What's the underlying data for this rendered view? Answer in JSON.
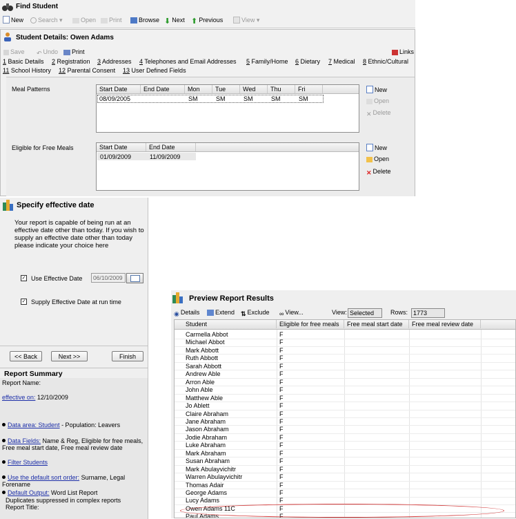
{
  "find_student": {
    "title": "Find Student",
    "toolbar": [
      "New",
      "Search",
      "Open",
      "Print",
      "Browse",
      "Next",
      "Previous",
      "View"
    ]
  },
  "student_details": {
    "title": "Student Details: Owen Adams",
    "toolbar": {
      "save": "Save",
      "undo": "Undo",
      "print": "Print",
      "links": "Links"
    },
    "tabs_row1": [
      {
        "num": "1",
        "label": "Basic Details"
      },
      {
        "num": "2",
        "label": "Registration"
      },
      {
        "num": "3",
        "label": "Addresses"
      },
      {
        "num": "4",
        "label": "Telephones and Email Addresses"
      },
      {
        "num": "5",
        "label": "Family/Home"
      },
      {
        "num": "6",
        "label": "Dietary"
      },
      {
        "num": "7",
        "label": "Medical"
      },
      {
        "num": "8",
        "label": "Ethnic/Cultural"
      }
    ],
    "tabs_row2": [
      {
        "num": "11",
        "label": "School History"
      },
      {
        "num": "12",
        "label": "Parental Consent"
      },
      {
        "num": "13",
        "label": "User Defined Fields"
      }
    ],
    "meal_patterns": {
      "label": "Meal Patterns",
      "columns": [
        "Start Date",
        "End Date",
        "Mon",
        "Tue",
        "Wed",
        "Thu",
        "Fri"
      ],
      "row": [
        "08/09/2005",
        "",
        "SM",
        "SM",
        "SM",
        "SM",
        "SM"
      ],
      "buttons": {
        "new": "New",
        "open": "Open",
        "delete": "Delete"
      }
    },
    "free_meals": {
      "label": "Eligible for Free Meals",
      "columns": [
        "Start Date",
        "End Date"
      ],
      "row": [
        "01/09/2009",
        "11/09/2009"
      ],
      "buttons": {
        "new": "New",
        "open": "Open",
        "delete": "Delete"
      }
    }
  },
  "effective_date": {
    "title": "Specify effective date",
    "description": "Your report is capable of being run at an effective date other than today. If you wish to supply an effective date other than  today please indicate your choice here",
    "use_effective_date": "Use Effective Date",
    "date_value": "06/10/2009",
    "supply_at_runtime": "Supply Effective Date at run time",
    "buttons": {
      "back": "<< Back",
      "next": "Next >>",
      "finish": "Finish"
    }
  },
  "report_summary": {
    "title": "Report Summary",
    "report_name_label": "Report Name:",
    "effective_on_label": "effective on:",
    "effective_on_value": "12/10/2009",
    "data_area_link": "Data area: Student",
    "data_area_rest": " - Population: Leavers",
    "data_fields_link": "Data Fields:",
    "data_fields_rest": " Name & Reg, Eligible for free meals, Free meal start date, Free meal review date",
    "filter_link": "Filter Students",
    "sort_link": "Use the default sort order:",
    "sort_rest": " Surname, Legal Forename",
    "output_link": "Default Output:",
    "output_rest": " Word List Report",
    "duplicates": "Duplicates suppressed in complex reports",
    "report_title_label": "Report Title:"
  },
  "preview": {
    "title": "Preview Report Results",
    "toolbar": {
      "details": "Details",
      "extend": "Extend",
      "exclude": "Exclude",
      "view": "View...",
      "view_label": "View:",
      "view_value": "Selected",
      "rows_label": "Rows:",
      "rows_value": "1773"
    },
    "columns": [
      "Student",
      "Eligible for free meals",
      "Free meal start date",
      "Free meal review date"
    ],
    "rows": [
      [
        "Carmella Abbot",
        "F"
      ],
      [
        "Michael Abbot",
        "F"
      ],
      [
        "Mark Abbott",
        "F"
      ],
      [
        "Ruth Abbott",
        "F"
      ],
      [
        "Sarah Abbott",
        "F"
      ],
      [
        "Andrew Able",
        "F"
      ],
      [
        "Arron Able",
        "F"
      ],
      [
        "John Able",
        "F"
      ],
      [
        "Matthew Able",
        "F"
      ],
      [
        "Jo Ablett",
        "F"
      ],
      [
        "Claire Abraham",
        "F"
      ],
      [
        "Jane Abraham",
        "F"
      ],
      [
        "Jason Abraham",
        "F"
      ],
      [
        "Jodie Abraham",
        "F"
      ],
      [
        "Luke Abraham",
        "F"
      ],
      [
        "Mark Abraham",
        "F"
      ],
      [
        "Susan Abraham",
        "F"
      ],
      [
        "Mark Abulayvichitr",
        "F"
      ],
      [
        "Warren Abulayvichitr",
        "F"
      ],
      [
        "Thomas Adair",
        "F"
      ],
      [
        "George Adams",
        "F"
      ],
      [
        "Lucy Adams",
        "F"
      ],
      [
        "Owen Adams  11C",
        "F"
      ],
      [
        "Paul Adams",
        "F"
      ]
    ]
  }
}
